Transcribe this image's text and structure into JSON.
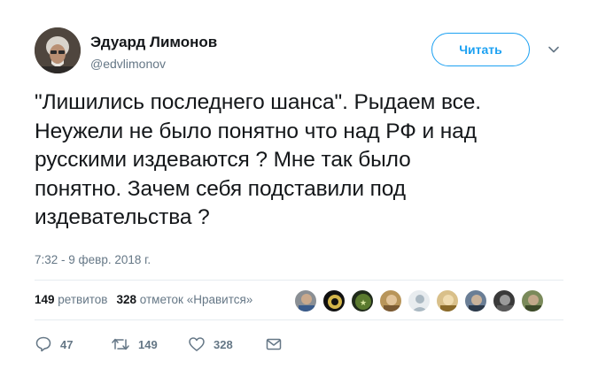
{
  "author": {
    "name": "Эдуард Лимонов",
    "handle": "@edvlimonov"
  },
  "follow_button": {
    "label": "Читать"
  },
  "tweet": {
    "text": "\"Лишились последнего шанса\". Рыдаем все.\nНеужели не было понятно что над РФ и над\nрусскими издеваются ? Мне так было\nпонятно. Зачем себя подставили под\nиздевательства ?",
    "timestamp": "7:32 - 9 февр. 2018 г."
  },
  "stats": {
    "retweets_count": "149",
    "retweets_label": "ретвитов",
    "likes_count": "328",
    "likes_label": "отметок «Нравится»"
  },
  "likers": [
    "liker-1",
    "liker-2",
    "liker-3",
    "liker-4",
    "liker-5",
    "liker-6",
    "liker-7",
    "liker-8",
    "liker-9"
  ],
  "actions": {
    "reply_count": "47",
    "retweet_count": "149",
    "like_count": "328"
  },
  "colors": {
    "accent": "#1da1f2",
    "muted": "#657786",
    "text": "#14171a",
    "separator": "#e6ecf0"
  },
  "icons": [
    "reply-icon",
    "retweet-icon",
    "like-icon",
    "message-icon",
    "chevron-down-icon"
  ]
}
